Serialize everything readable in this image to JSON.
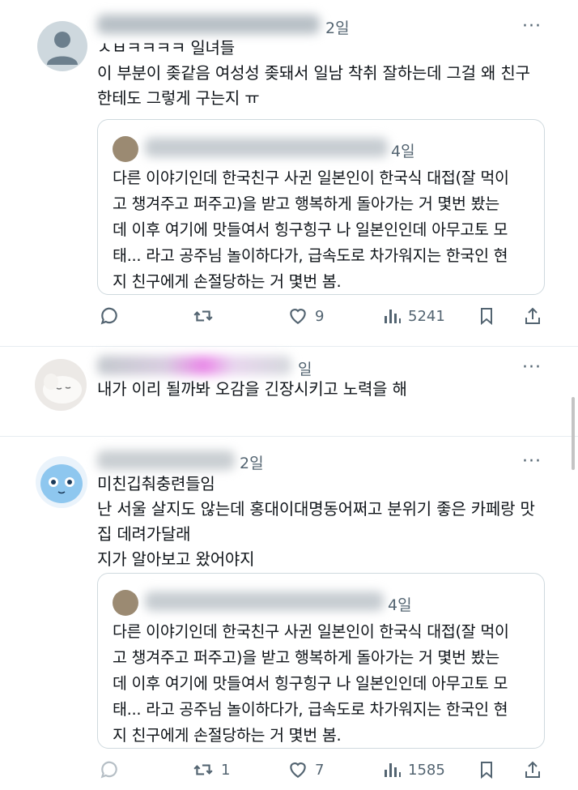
{
  "tweets": [
    {
      "time": "2일",
      "more": "···",
      "lines": [
        "ㅅㅂㅋㅋㅋㅋ 일녀들",
        "이 부분이 좆같음 여성성 좆돼서 일남 착취 잘하는데 그걸 왜 친구",
        "한테도 그렇게 구는지 ㅠ"
      ],
      "quote": {
        "time": "4일",
        "lines": [
          "다른 이야기인데 한국친구 사귄 일본인이 한국식 대접(잘 먹이",
          "고 챙겨주고 퍼주고)을 받고 행복하게 돌아가는 거 몇번 봤는",
          "데 이후 여기에 맛들여서 힝구힝구 나 일본인인데 아무고토 모",
          "태... 라고 공주님 놀이하다가, 급속도로 차가워지는 한국인 현",
          "지 친구에게 손절당하는 거 몇번 봄."
        ]
      },
      "actions": {
        "likes": "9",
        "views": "5241"
      }
    },
    {
      "time": "일",
      "more": "···",
      "lines": [
        "내가 이리 될까봐 오감을 긴장시키고 노력을 해"
      ]
    },
    {
      "time": "2일",
      "more": "···",
      "lines": [
        "미친깁춰충련들임",
        "난 서울 살지도 않는데 홍대이대명동어쩌고 분위기 좋은 카페랑 맛",
        "집 데려가달래",
        "지가 알아보고 왔어야지"
      ],
      "quote": {
        "time": "4일",
        "lines": [
          "다른 이야기인데 한국친구 사귄 일본인이 한국식 대접(잘 먹이",
          "고 챙겨주고 퍼주고)을 받고 행복하게 돌아가는 거 몇번 봤는",
          "데 이후 여기에 맛들여서 힝구힝구 나 일본인인데 아무고토 모",
          "태... 라고 공주님 놀이하다가, 급속도로 차가워지는 한국인 현",
          "지 친구에게 손절당하는 거 몇번 봄."
        ]
      },
      "actions": {
        "retweets": "1",
        "likes": "7",
        "views": "1585"
      }
    }
  ],
  "colors": {
    "text": "#0f1419",
    "muted": "#536471",
    "border": "#cfd9de"
  },
  "icons": [
    "reply-icon",
    "retweet-icon",
    "heart-icon",
    "views-icon",
    "bookmark-icon",
    "share-icon"
  ]
}
